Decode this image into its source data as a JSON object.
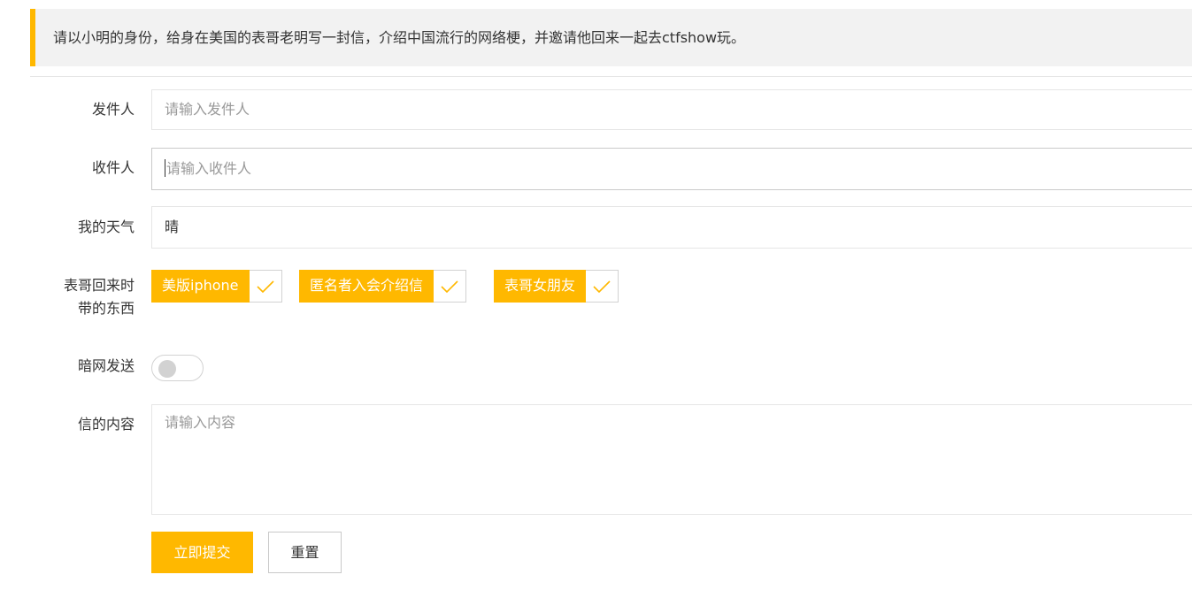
{
  "notice": {
    "text": "请以小明的身份，给身在美国的表哥老明写一封信，介绍中国流行的网络梗，并邀请他回来一起去ctfshow玩。",
    "accent_color": "#ffb800"
  },
  "form": {
    "sender": {
      "label": "发件人",
      "placeholder": "请输入发件人",
      "value": ""
    },
    "receiver": {
      "label": "收件人",
      "placeholder": "请输入收件人",
      "value": "",
      "focused": true
    },
    "weather": {
      "label": "我的天气",
      "value": "晴"
    },
    "gifts": {
      "label_line1": "表哥回来时",
      "label_line2": "带的东西",
      "options": [
        {
          "label": "美版iphone",
          "checked": true
        },
        {
          "label": "匿名者入会介绍信",
          "checked": true
        },
        {
          "label": "表哥女朋友",
          "checked": true
        }
      ]
    },
    "darknet": {
      "label": "暗网发送",
      "enabled": false
    },
    "content": {
      "label": "信的内容",
      "placeholder": "请输入内容"
    },
    "buttons": {
      "submit": "立即提交",
      "reset": "重置"
    }
  },
  "icons": {
    "check": "check-icon"
  },
  "colors": {
    "primary": "#ffb800",
    "border": "#e6e6e6",
    "placeholder": "#999999"
  }
}
